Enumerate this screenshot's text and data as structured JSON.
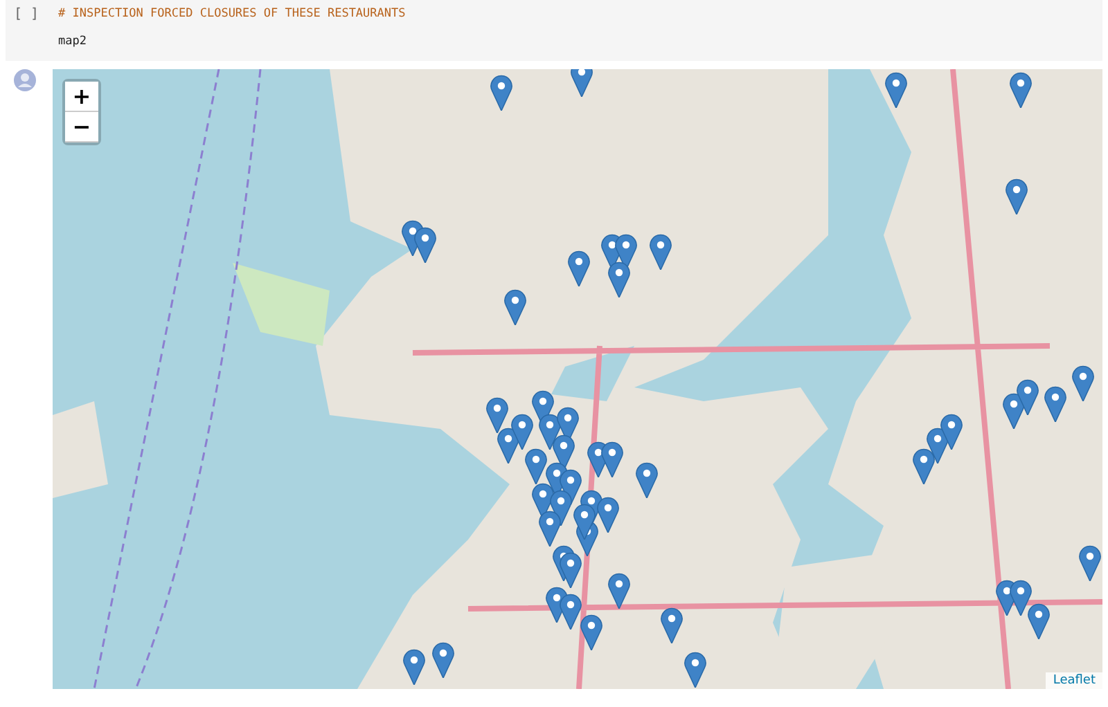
{
  "code_cell": {
    "prompt": "[ ]",
    "lines": [
      {
        "kind": "comment",
        "text": "# INSPECTION FORCED CLOSURES OF THESE RESTAURANTS"
      },
      {
        "kind": "code",
        "text": "map2"
      }
    ]
  },
  "map": {
    "zoom_in": "+",
    "zoom_out": "−",
    "attribution": "Leaflet"
  }
}
